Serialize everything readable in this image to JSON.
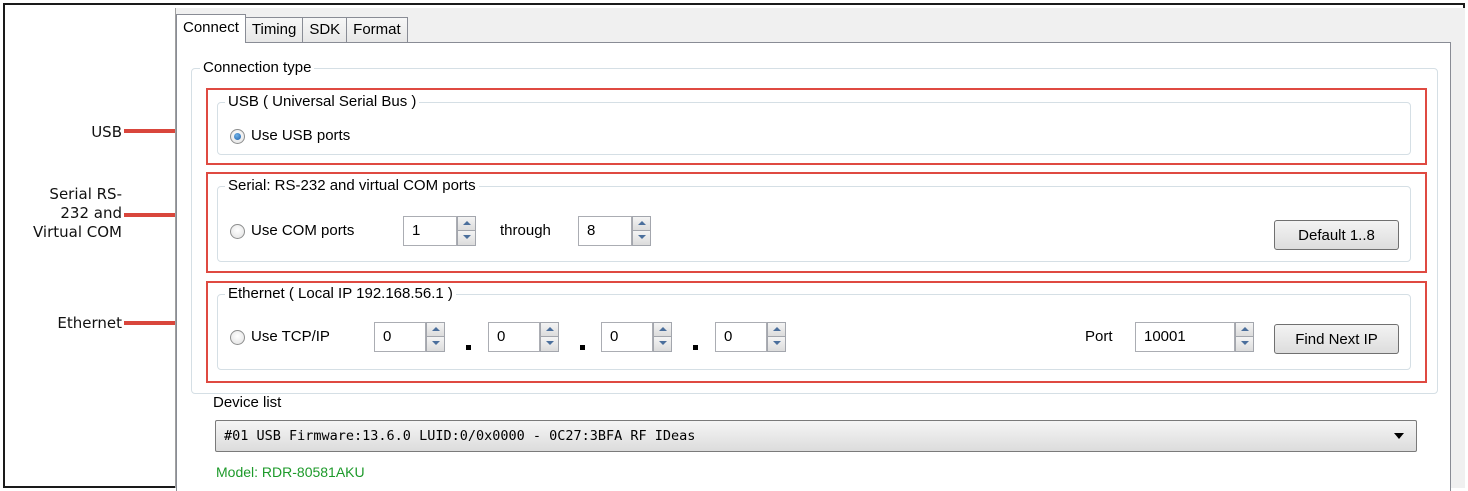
{
  "tabs": [
    {
      "label": "Connect",
      "active": true
    },
    {
      "label": "Timing",
      "active": false
    },
    {
      "label": "SDK",
      "active": false
    },
    {
      "label": "Format",
      "active": false
    }
  ],
  "callouts": {
    "usb": "USB",
    "serial_line1": "Serial RS-",
    "serial_line2": "232 and",
    "serial_line3": "Virtual COM",
    "ethernet": "Ethernet"
  },
  "connection_type_label": "Connection type",
  "usb": {
    "legend": "USB ( Universal Serial Bus )",
    "radio_label": "Use USB ports",
    "selected": true
  },
  "serial": {
    "legend": "Serial: RS-232 and virtual COM ports",
    "radio_label": "Use COM ports",
    "from_value": "1",
    "through_label": "through",
    "to_value": "8",
    "default_button": "Default 1..8"
  },
  "ethernet": {
    "legend": "Ethernet ( Local IP 192.168.56.1 )",
    "radio_label": "Use TCP/IP",
    "ip": [
      "0",
      "0",
      "0",
      "0"
    ],
    "port_label": "Port",
    "port_value": "10001",
    "find_button": "Find Next IP"
  },
  "device_list": {
    "label": "Device list",
    "selected": "#01 USB Firmware:13.6.0 LUID:0/0x0000 - 0C27:3BFA RF IDeas",
    "model": "Model: RDR-80581AKU"
  },
  "colors": {
    "callout_red": "#df4a41",
    "model_green": "#1d9a2a"
  }
}
